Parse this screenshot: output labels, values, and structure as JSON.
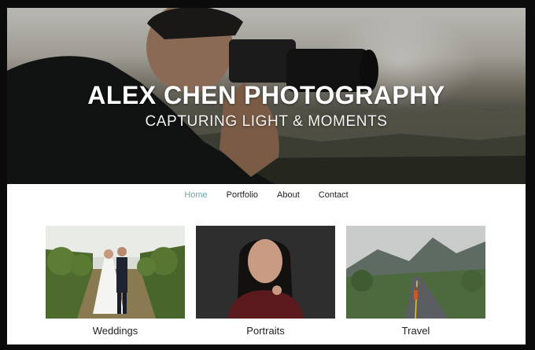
{
  "hero": {
    "title": "ALEX CHEN PHOTOGRAPHY",
    "subtitle": "CAPTURING LIGHT & MOMENTS"
  },
  "nav": {
    "items": [
      {
        "label": "Home",
        "active": true
      },
      {
        "label": "Portfolio",
        "active": false
      },
      {
        "label": "About",
        "active": false
      },
      {
        "label": "Contact",
        "active": false
      }
    ]
  },
  "gallery": [
    {
      "caption": "Weddings"
    },
    {
      "caption": "Portraits"
    },
    {
      "caption": "Travel"
    }
  ],
  "colors": {
    "nav_active": "#6aa6a4",
    "text": "#222222"
  }
}
